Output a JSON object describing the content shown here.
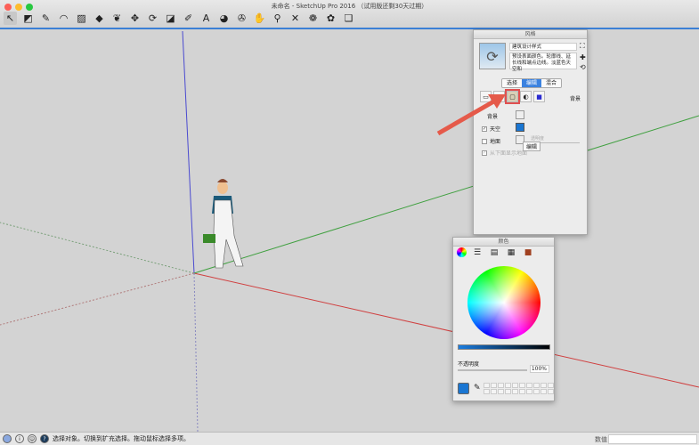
{
  "window": {
    "title": "未命名 - SketchUp Pro 2016 （试用版还剩30天过期）"
  },
  "toolbar": {
    "tools": [
      {
        "name": "select-icon",
        "glyph": "↖"
      },
      {
        "name": "eraser-icon",
        "glyph": "◩"
      },
      {
        "name": "pencil-icon",
        "glyph": "✎"
      },
      {
        "name": "arc-icon",
        "glyph": "◠"
      },
      {
        "name": "rectangle-icon",
        "glyph": "▨"
      },
      {
        "name": "push-pull-icon",
        "glyph": "◆"
      },
      {
        "name": "follow-me-icon",
        "glyph": "❦"
      },
      {
        "name": "move-icon",
        "glyph": "✥"
      },
      {
        "name": "rotate-icon",
        "glyph": "⟳"
      },
      {
        "name": "scale-icon",
        "glyph": "◪"
      },
      {
        "name": "tape-measure-icon",
        "glyph": "✐"
      },
      {
        "name": "text-icon",
        "glyph": "A"
      },
      {
        "name": "paint-bucket-icon",
        "glyph": "◕"
      },
      {
        "name": "orbit-icon",
        "glyph": "✇"
      },
      {
        "name": "pan-icon",
        "glyph": "✋"
      },
      {
        "name": "zoom-icon",
        "glyph": "⚲"
      },
      {
        "name": "zoom-extents-icon",
        "glyph": "✕"
      },
      {
        "name": "warehouse-icon",
        "glyph": "❁"
      },
      {
        "name": "extension-warehouse-icon",
        "glyph": "✿"
      },
      {
        "name": "layout-icon",
        "glyph": "❏"
      }
    ]
  },
  "styles_panel": {
    "title": "风格",
    "style_name": "建筑设计样式",
    "style_desc": "预设表面颜色。轮廓线、延长线和端点边线。淡蓝色天空和",
    "tabs": [
      "选择",
      "编辑",
      "混合"
    ],
    "active_tab": "编辑",
    "background_label": "背景",
    "rows": [
      {
        "label": "背景",
        "checked": false
      },
      {
        "label": "天空",
        "checked": true
      },
      {
        "label": "地面",
        "checked": false
      },
      {
        "label": "从下面显示地面",
        "checked": true
      }
    ],
    "transparency_label": "透明度",
    "tooltip": "编辑",
    "sky_color": "#1a76d2"
  },
  "colors_panel": {
    "title": "颜色",
    "opacity_label": "不透明度",
    "opacity_value": "100%",
    "current_color": "#1a76d2"
  },
  "status": {
    "message": "选择对象。切换到扩充选择。拖动鼠标选择多项。",
    "measure_label": "数值"
  },
  "colors": {
    "x_axis": "#d04040",
    "y_axis": "#40a040",
    "z_axis": "#4040d0",
    "accent": "#3b82e0",
    "highlight": "#e05050"
  }
}
